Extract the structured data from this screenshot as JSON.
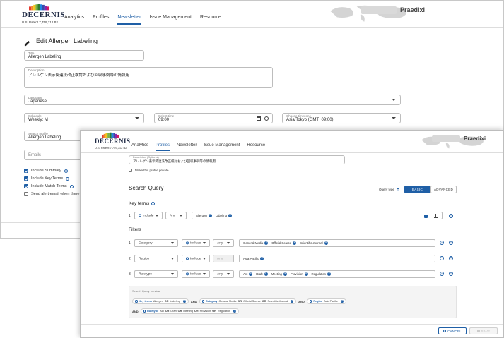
{
  "brand": {
    "name": "DECERNIS",
    "patent": "U.S. Patent 7,759,712 B2"
  },
  "company": "Praedixi",
  "nav": [
    "Analytics",
    "Profiles",
    "Newsletter",
    "Issue Management",
    "Resource"
  ],
  "back_window": {
    "active_nav": "Newsletter",
    "page_title": "Edit Allergen Labeling",
    "fields": {
      "title": {
        "label": "Title",
        "value": "Allergen Labeling"
      },
      "description": {
        "label": "Description",
        "value": "アレルゲン表示関連法改正検討および回収事例等の情報用"
      },
      "language": {
        "label": "Language",
        "value": "Japanese"
      },
      "schedule": {
        "label": "Schedule",
        "value": "Weekly: M"
      },
      "select_time": {
        "label": "Select time",
        "value": "09:00"
      },
      "timezone": {
        "label": "Choose timezone",
        "value": "Asia/Tokyo (GMT+09:00)"
      },
      "profile": {
        "label": "Search profile",
        "value": "Allergen Labeling"
      },
      "emails": {
        "placeholder": "Emails"
      }
    },
    "checkboxes": [
      {
        "label": "Include Summary",
        "checked": true
      },
      {
        "label": "Include Key Terms",
        "checked": true
      },
      {
        "label": "Include Match Terms",
        "checked": true
      },
      {
        "label": "Send alert email when there are",
        "checked": false
      }
    ]
  },
  "front_window": {
    "active_nav": "Profiles",
    "description": {
      "label": "Description (Optional)",
      "value": "アレルゲン表示関連法改正検討および回収事例等の情報用"
    },
    "private_label": "Make this profile private",
    "search_query_title": "Search Query",
    "query_type_label": "Query type",
    "query_types": [
      "BASIC",
      "ADVANCED"
    ],
    "active_query_type": "BASIC",
    "key_terms": {
      "title": "Key terms",
      "row": {
        "num": "1",
        "include": "Include",
        "match": "Any",
        "chips": [
          "Allergen",
          "Labeling"
        ]
      }
    },
    "filters_title": "Filters",
    "filters": [
      {
        "num": "1",
        "field": "Category",
        "include": "Include",
        "match": "Any",
        "chips": [
          "General Media",
          "Official Source",
          "Scientific Journal"
        ]
      },
      {
        "num": "2",
        "field": "Region",
        "include": "Include",
        "match": "Any",
        "chips": [
          "Asia Pacific"
        ]
      },
      {
        "num": "3",
        "field": "Ruletype",
        "include": "Include",
        "match": "Any",
        "chips": [
          "Act",
          "Draft",
          "Meeting",
          "Provision",
          "Regulation"
        ]
      }
    ],
    "preview": {
      "title": "Search Query preview",
      "line1": {
        "keyterms": {
          "key": "Key terms",
          "a": "Allergen",
          "or": "OR",
          "b": "Labeling"
        },
        "and1": "AND",
        "category": {
          "key": "Category",
          "a": "General Media",
          "b": "Official Source",
          "c": "Scientific Journal",
          "or": "OR"
        },
        "and2": "AND",
        "region": {
          "key": "Region",
          "a": "Asia Pacific"
        }
      },
      "line2": {
        "and": "AND",
        "ruletype": {
          "key": "Ruletype",
          "a": "Act",
          "b": "Draft",
          "c": "Meeting",
          "d": "Provision",
          "e": "Regulation",
          "or": "OR"
        }
      }
    },
    "buttons": {
      "cancel": "CANCEL",
      "save": "SAVE"
    }
  }
}
